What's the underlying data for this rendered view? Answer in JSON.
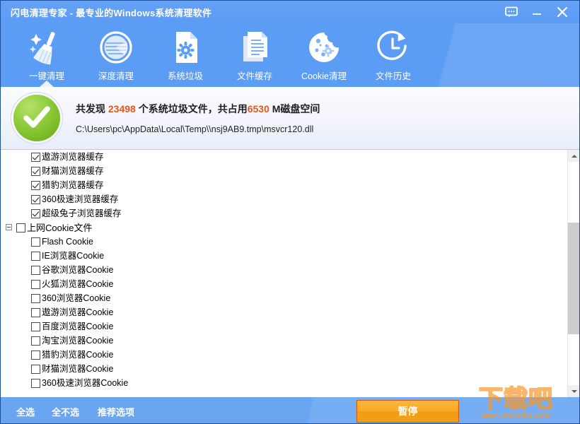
{
  "window": {
    "title": "闪电清理专家 - 最专业的Windows系统清理软件",
    "controls": [
      {
        "name": "feedback",
        "icon": "speech-bubble-icon",
        "label": ""
      },
      {
        "name": "minimize",
        "icon": "minimize-icon",
        "label": ""
      },
      {
        "name": "close",
        "icon": "close-icon",
        "label": ""
      }
    ]
  },
  "toolbar": {
    "tabs": [
      {
        "label": "一键清理",
        "icon": "broom-icon",
        "active": true
      },
      {
        "label": "深度清理",
        "icon": "disc-icon",
        "active": false
      },
      {
        "label": "系统垃圾",
        "icon": "document-gear-icon",
        "active": false
      },
      {
        "label": "文件缓存",
        "icon": "documents-icon",
        "active": false
      },
      {
        "label": "Cookie清理",
        "icon": "cookie-icon",
        "active": false
      },
      {
        "label": "文件历史",
        "icon": "clock-history-icon",
        "active": false
      }
    ]
  },
  "banner": {
    "icon": "green-check-icon",
    "summary_prefix": "共发现 ",
    "file_count": "23498",
    "summary_middle": " 个系统垃圾文件，共占用",
    "size_value": "6530",
    "summary_suffix": " M磁盘空间",
    "current_path": "C:\\Users\\pc\\AppData\\Local\\Temp\\\\nsj9AB9.tmp\\msvcr120.dll",
    "highlight_color": "#e8561b"
  },
  "list": {
    "items": [
      {
        "label": "遨游浏览器缓存",
        "checked": true,
        "level": "child"
      },
      {
        "label": "财猫浏览器缓存",
        "checked": true,
        "level": "child"
      },
      {
        "label": "猎豹浏览器缓存",
        "checked": true,
        "level": "child"
      },
      {
        "label": "360极速浏览器缓存",
        "checked": true,
        "level": "child"
      },
      {
        "label": "超级兔子浏览器缓存",
        "checked": true,
        "level": "child"
      },
      {
        "label": "上网Cookie文件",
        "checked": false,
        "level": "parent",
        "expanded": true
      },
      {
        "label": "Flash Cookie",
        "checked": false,
        "level": "child"
      },
      {
        "label": "IE浏览器Cookie",
        "checked": false,
        "level": "child"
      },
      {
        "label": "谷歌浏览器Cookie",
        "checked": false,
        "level": "child"
      },
      {
        "label": "火狐浏览器Cookie",
        "checked": false,
        "level": "child"
      },
      {
        "label": "360浏览器Cookie",
        "checked": false,
        "level": "child"
      },
      {
        "label": "遨游浏览器Cookie",
        "checked": false,
        "level": "child"
      },
      {
        "label": "百度浏览器Cookie",
        "checked": false,
        "level": "child"
      },
      {
        "label": "淘宝浏览器Cookie",
        "checked": false,
        "level": "child"
      },
      {
        "label": "猎豹浏览器Cookie",
        "checked": false,
        "level": "child"
      },
      {
        "label": "财猫浏览器Cookie",
        "checked": false,
        "level": "child"
      },
      {
        "label": "360极速浏览器Cookie",
        "checked": false,
        "level": "child"
      }
    ]
  },
  "bottom": {
    "select_all": "全选",
    "select_none": "全不选",
    "recommended": "推荐选项",
    "action_button": "暂停"
  },
  "watermark": {
    "top_text": "下载吧",
    "bottom_text": "www.xiazaiba.com"
  },
  "colors": {
    "accent_blue": "#5b9cf4",
    "action_orange": "#f9ab24",
    "highlight_orange": "#e8561b",
    "check_green": "#8fcc3b"
  }
}
